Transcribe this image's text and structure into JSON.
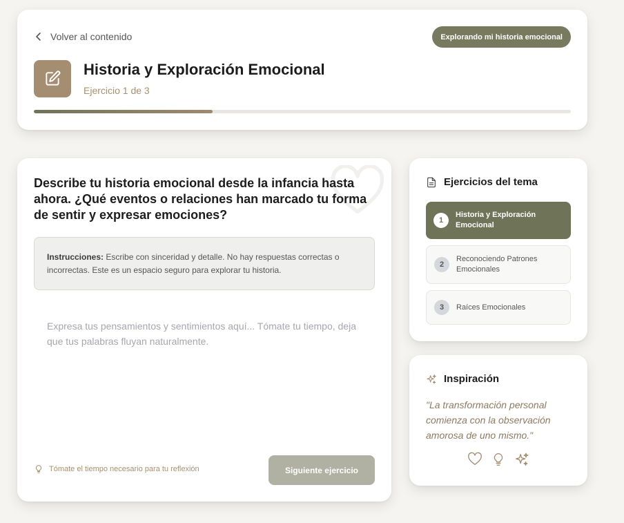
{
  "header": {
    "back_label": "Volver al contenido",
    "topic_badge": "Explorando mi historia emocional",
    "title": "Historia y Exploración Emocional",
    "subtitle": "Ejercicio 1 de 3",
    "progress": 0.333
  },
  "main": {
    "question": "Describe tu historia emocional desde la infancia hasta ahora. ¿Qué eventos o relaciones han marcado tu forma de sentir y expresar emociones?",
    "instructions_label": "Instrucciones:",
    "instructions_text": " Escribe con sinceridad y detalle. No hay respuestas correctas o incorrectas. Este es un espacio seguro para explorar tu historia.",
    "input_value": "",
    "input_placeholder": "Expresa tus pensamientos y sentimientos aquí... Tómate tu tiempo, deja que tus palabras fluyan naturalmente.",
    "hint": "Tómate el tiempo necesario para tu reflexión",
    "next_button": "Siguiente ejercicio"
  },
  "sidebar": {
    "title": "Ejercicios del tema",
    "items": [
      {
        "number": "1",
        "label": "Historia y Exploración Emocional",
        "active": true
      },
      {
        "number": "2",
        "label": "Reconociendo Patrones Emocionales",
        "active": false
      },
      {
        "number": "3",
        "label": "Raíces Emocionales",
        "active": false
      }
    ]
  },
  "inspiration": {
    "title": "Inspiración",
    "quote": "\"La transformación personal comienza con la observación amorosa de uno mismo.\"",
    "icons": [
      "heart-icon",
      "lightbulb-icon",
      "sparkles-icon"
    ]
  },
  "colors": {
    "accent_olive": "#6f7358",
    "accent_brown": "#a58d71",
    "badge": "#777a5f",
    "button_disabled": "#b0b1a3",
    "quote_text": "#8d7a62"
  }
}
